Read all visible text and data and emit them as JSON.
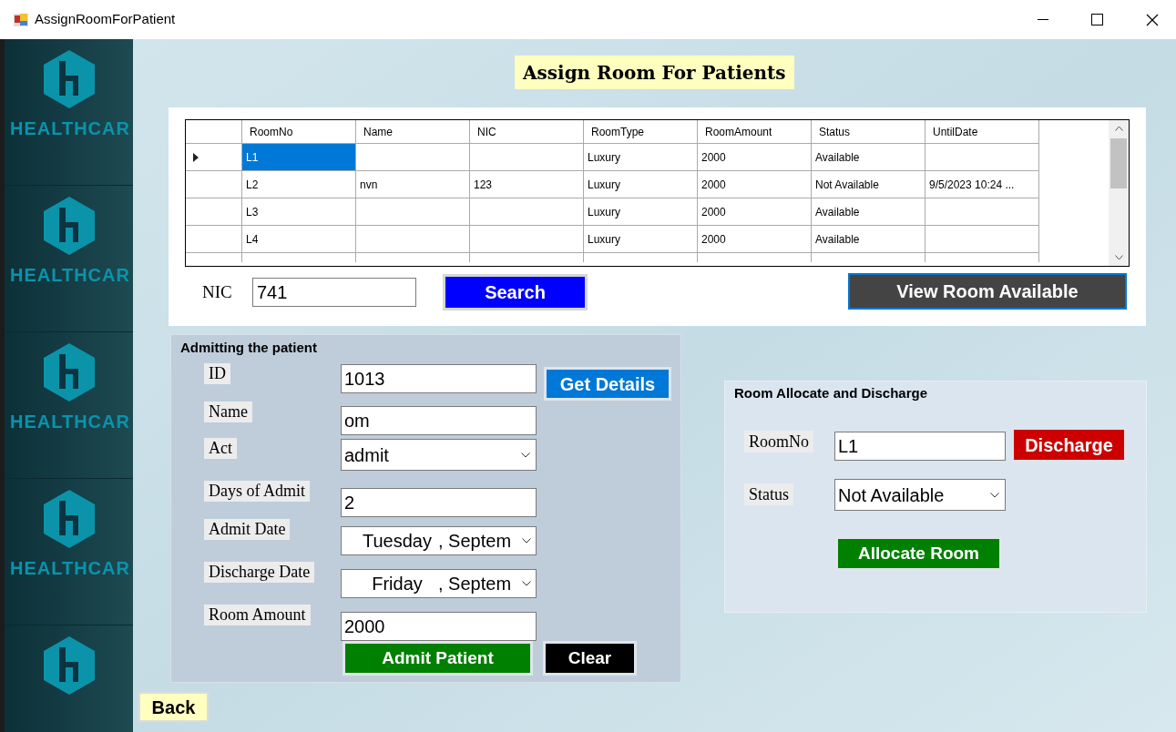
{
  "window": {
    "title": "AssignRoomForPatient"
  },
  "sidebar": {
    "logos": [
      "HEALTHCAR",
      "HEALTHCAR",
      "HEALTHCAR",
      "HEALTHCAR"
    ]
  },
  "heading": "Assign Room For Patients",
  "table": {
    "columns": [
      "RoomNo",
      "Name",
      "NIC",
      "RoomType",
      "RoomAmount",
      "Status",
      "UntilDate"
    ],
    "rows": [
      {
        "cells": [
          "L1",
          "",
          "",
          "Luxury",
          "2000",
          "Available",
          ""
        ],
        "selected": true
      },
      {
        "cells": [
          "L2",
          "nvn",
          "123",
          "Luxury",
          "2000",
          "Not Available",
          "9/5/2023 10:24 ..."
        ],
        "selected": false
      },
      {
        "cells": [
          "L3",
          "",
          "",
          "Luxury",
          "2000",
          "Available",
          ""
        ],
        "selected": false
      },
      {
        "cells": [
          "L4",
          "",
          "",
          "Luxury",
          "2000",
          "Available",
          ""
        ],
        "selected": false
      }
    ]
  },
  "search": {
    "label": "NIC",
    "value": "741",
    "button": "Search"
  },
  "view_button": "View Room Available",
  "admit": {
    "title": "Admitting the patient",
    "fields": [
      {
        "label": "ID",
        "kind": "text",
        "value": "1013"
      },
      {
        "label": "Name",
        "kind": "text",
        "value": "om"
      },
      {
        "label": "Act",
        "kind": "dropdown",
        "value": "admit"
      },
      {
        "label": "Days of Admit",
        "kind": "text",
        "value": "2"
      },
      {
        "label": "Admit Date",
        "kind": "date",
        "value": "Tuesday",
        "rest": ", Septem"
      },
      {
        "label": "Discharge Date",
        "kind": "date",
        "value": "Friday",
        "rest": ", Septem"
      },
      {
        "label": "Room Amount",
        "kind": "text",
        "value": "2000"
      }
    ],
    "details_button": "Get Details",
    "admit_button": "Admit Patient",
    "clear_button": "Clear"
  },
  "allocate": {
    "title": "Room Allocate and Discharge",
    "room_label": "RoomNo",
    "room_value": "L1",
    "discharge_button": "Discharge",
    "status_label": "Status",
    "status_value": "Not Available",
    "allocate_button": "Allocate Room"
  },
  "back_button": "Back"
}
